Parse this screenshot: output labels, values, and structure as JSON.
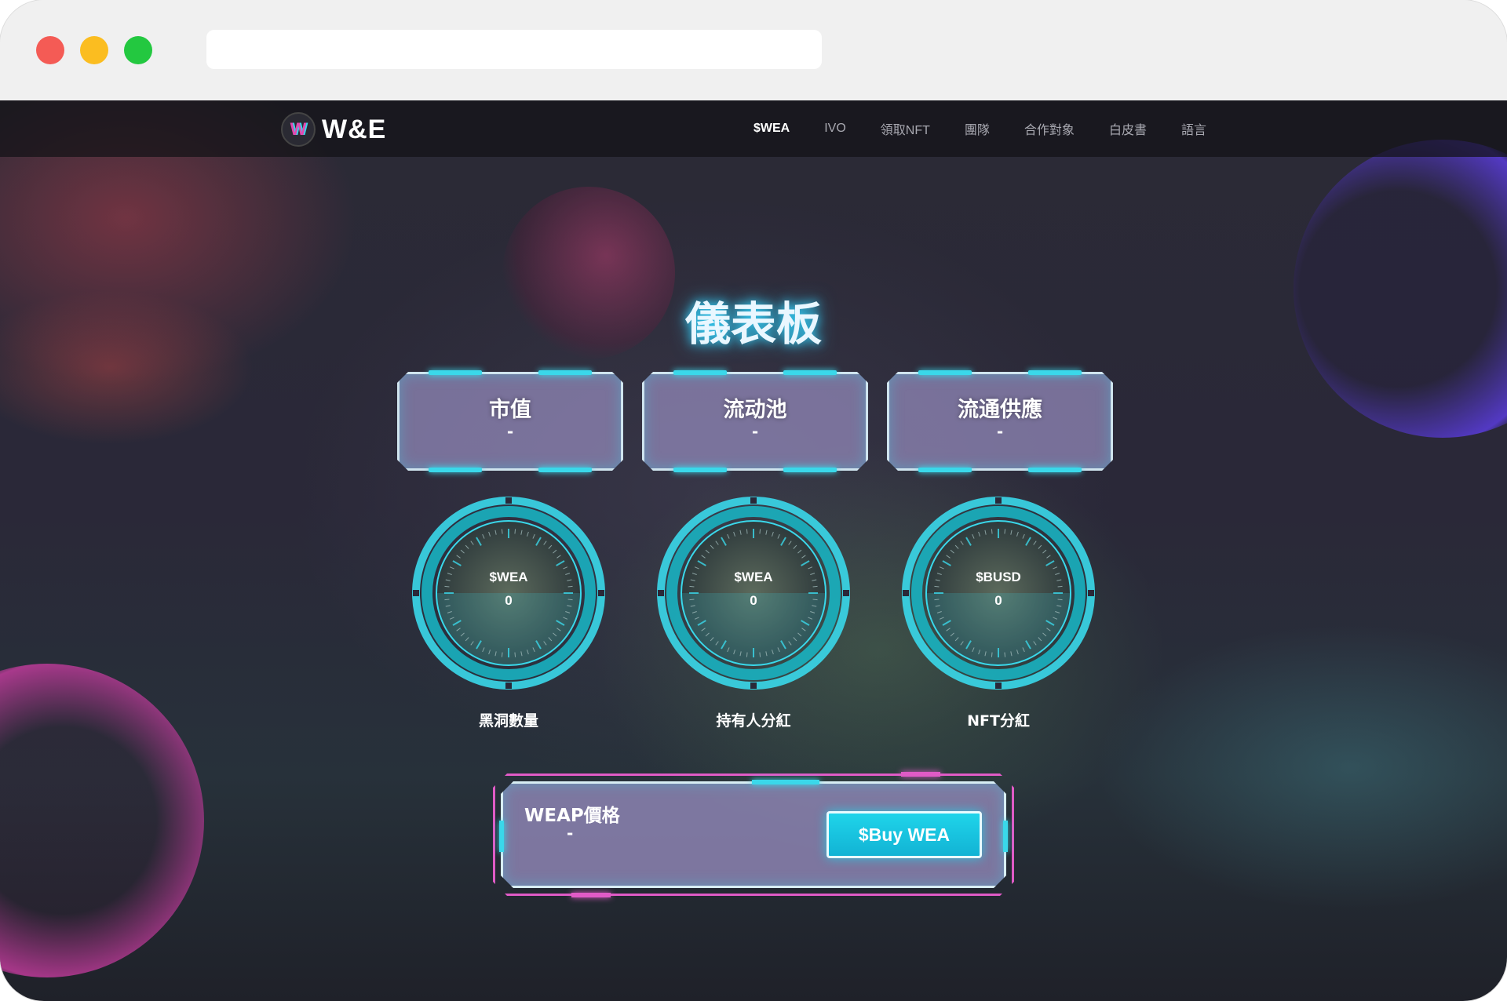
{
  "nav": {
    "logo_mark": "W",
    "logo_text": "W&E",
    "links": [
      "$WEA",
      "IVO",
      "領取NFT",
      "團隊",
      "合作對象",
      "白皮書",
      "語言"
    ]
  },
  "title": "儀表板",
  "stats": [
    {
      "label": "市值",
      "value": "-"
    },
    {
      "label": "流动池",
      "value": "-"
    },
    {
      "label": "流通供應",
      "value": "-"
    }
  ],
  "gauges": [
    {
      "token": "$WEA",
      "value": "0",
      "caption": "黑洞數量"
    },
    {
      "token": "$WEA",
      "value": "0",
      "caption": "持有人分紅"
    },
    {
      "token": "$BUSD",
      "value": "0",
      "caption": "NFT分紅"
    }
  ],
  "price": {
    "label": "WEAP價格",
    "value": "-",
    "buy_label": "$Buy WEA"
  },
  "colors": {
    "accent_cyan": "#3ad8ea",
    "accent_pink": "#e05bc6",
    "card_fill": "#968cbe"
  }
}
